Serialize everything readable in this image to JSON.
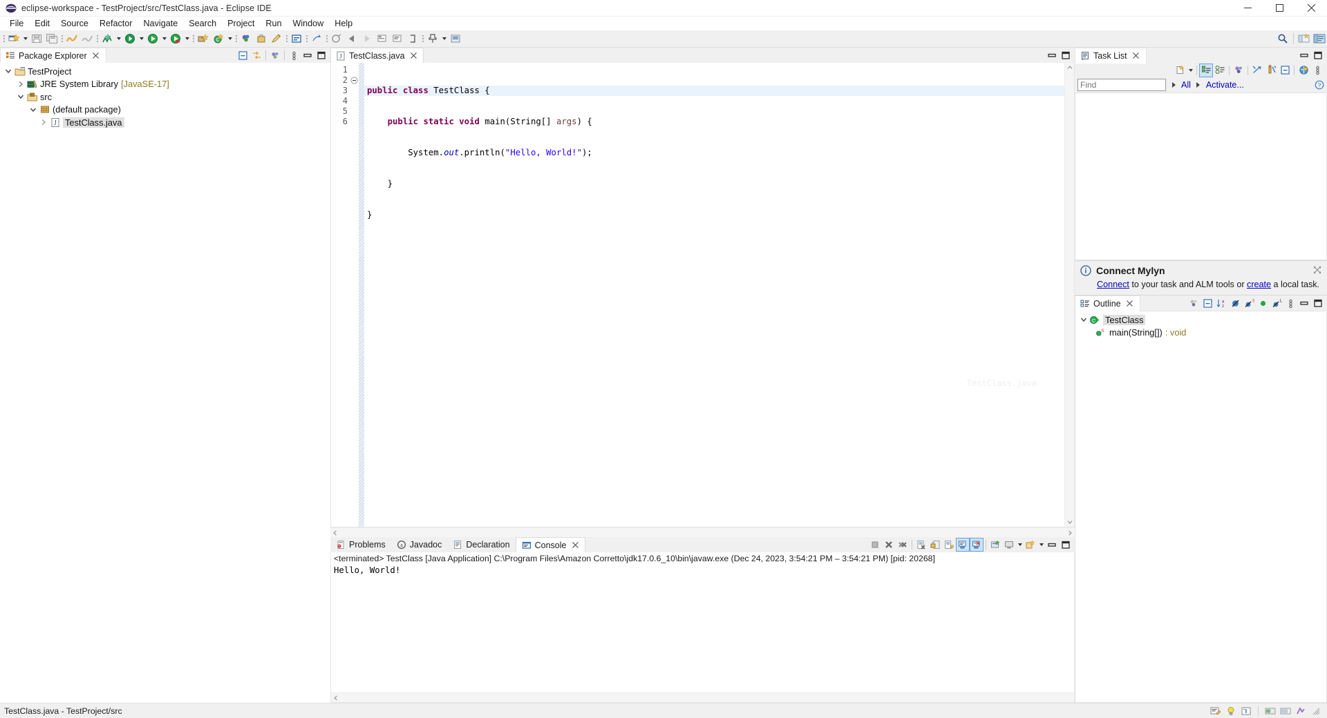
{
  "window": {
    "title": "eclipse-workspace - TestProject/src/TestClass.java - Eclipse IDE",
    "app_icon": "eclipse-icon",
    "minimize_label": "Minimize",
    "maximize_label": "Maximize",
    "close_label": "Close"
  },
  "menubar": {
    "items": [
      {
        "label": "File"
      },
      {
        "label": "Edit"
      },
      {
        "label": "Source"
      },
      {
        "label": "Refactor"
      },
      {
        "label": "Navigate"
      },
      {
        "label": "Search"
      },
      {
        "label": "Project"
      },
      {
        "label": "Run"
      },
      {
        "label": "Window"
      },
      {
        "label": "Help"
      }
    ]
  },
  "toolbar": {
    "items": [
      {
        "icon": "new-wizard-icon",
        "name": "new-button",
        "dropdown": true
      },
      {
        "icon": "save-icon",
        "name": "save-button",
        "dropdown": false
      },
      {
        "icon": "save-all-icon",
        "name": "save-all-button",
        "dropdown": false
      },
      {
        "icon": "build-all-icon",
        "name": "build-all-button",
        "dropdown": false
      },
      {
        "icon": "build-project-icon",
        "name": "build-project-button",
        "dropdown": false
      },
      {
        "icon": "new-java-project-icon",
        "name": "new-java-project-button",
        "dropdown": true
      },
      {
        "icon": "debug-icon",
        "name": "debug-button",
        "dropdown": true
      },
      {
        "icon": "run-icon",
        "name": "run-button",
        "dropdown": true
      },
      {
        "icon": "coverage-icon",
        "name": "coverage-button",
        "dropdown": true
      },
      {
        "icon": "new-package-icon",
        "name": "new-package-button",
        "dropdown": false
      },
      {
        "icon": "new-class-icon",
        "name": "new-class-button",
        "dropdown": true
      },
      {
        "icon": "search-global-icon",
        "name": "open-type-button",
        "dropdown": false
      },
      {
        "icon": "open-task-icon",
        "name": "open-task-button",
        "dropdown": false
      },
      {
        "icon": "last-edit-icon",
        "name": "last-edit-location-button",
        "dropdown": false
      },
      {
        "icon": "toggle-mark-occurrences-icon",
        "name": "toggle-mark-occurrences-button",
        "dropdown": false
      },
      {
        "icon": "prev-annotation-icon",
        "name": "previous-annotation-button",
        "dropdown": false
      },
      {
        "icon": "next-annotation-icon",
        "name": "next-annotation-button",
        "dropdown": false
      },
      {
        "icon": "back-icon",
        "name": "back-button",
        "dropdown": true
      },
      {
        "icon": "forward-icon",
        "name": "forward-button",
        "dropdown": true
      },
      {
        "icon": "pin-editor-icon",
        "name": "pin-editor-button",
        "dropdown": false
      }
    ],
    "right_items": [
      {
        "icon": "search-icon",
        "name": "quick-access-search"
      },
      {
        "icon": "open-perspective-icon",
        "name": "open-perspective-button"
      },
      {
        "icon": "java-perspective-icon",
        "name": "java-perspective-button"
      }
    ]
  },
  "package_explorer": {
    "tab_label": "Package Explorer",
    "tab_icon": "package-explorer-icon",
    "tools": [
      {
        "icon": "collapse-all-icon",
        "name": "collapse-all-button"
      },
      {
        "icon": "link-with-editor-icon",
        "name": "link-with-editor-button"
      },
      {
        "icon": "focus-on-active-task-icon",
        "name": "focus-on-active-task-button"
      },
      {
        "icon": "view-menu-icon",
        "name": "view-menu-button"
      },
      {
        "icon": "minimize-icon",
        "name": "minimize-view-button"
      },
      {
        "icon": "maximize-icon",
        "name": "maximize-view-button"
      }
    ],
    "tree": [
      {
        "label": "TestProject",
        "suffix": "",
        "indent": 0,
        "twisty": "down",
        "icon": "java-project-icon",
        "selected": false
      },
      {
        "label": "JRE System Library",
        "suffix": "[JavaSE-17]",
        "indent": 1,
        "twisty": "right",
        "icon": "library-icon",
        "selected": false
      },
      {
        "label": "src",
        "suffix": "",
        "indent": 1,
        "twisty": "down",
        "icon": "source-folder-icon",
        "selected": false
      },
      {
        "label": "(default package)",
        "suffix": "",
        "indent": 2,
        "twisty": "down",
        "icon": "package-icon",
        "selected": false
      },
      {
        "label": "TestClass.java",
        "suffix": "",
        "indent": 3,
        "twisty": "right",
        "icon": "java-file-icon",
        "selected": true
      }
    ]
  },
  "editor": {
    "tab_label": "TestClass.java",
    "tab_icon": "java-file-icon",
    "tools": [
      {
        "icon": "restore-icon",
        "name": "restore-editor-button"
      },
      {
        "icon": "maximize-icon",
        "name": "maximize-editor-button"
      }
    ],
    "watermark": "TestClass.java",
    "line_numbers": [
      "1",
      "2",
      "3",
      "4",
      "5",
      "6"
    ],
    "fold_markers": [
      "",
      "collapse",
      "",
      "",
      "",
      ""
    ],
    "current_line": 1,
    "code_lines": [
      [
        {
          "t": "public ",
          "c": "kw"
        },
        {
          "t": "class ",
          "c": "kw"
        },
        {
          "t": "TestClass {",
          "c": "plain"
        }
      ],
      [
        {
          "t": "    ",
          "c": "plain"
        },
        {
          "t": "public static void ",
          "c": "kw"
        },
        {
          "t": "main(",
          "c": "plain"
        },
        {
          "t": "String",
          "c": "plain"
        },
        {
          "t": "[] ",
          "c": "plain"
        },
        {
          "t": "args",
          "c": "pv"
        },
        {
          "t": ") {",
          "c": "plain"
        }
      ],
      [
        {
          "t": "        System.",
          "c": "plain"
        },
        {
          "t": "out",
          "c": "fld"
        },
        {
          "t": ".println(",
          "c": "plain"
        },
        {
          "t": "\"Hello, World!\"",
          "c": "str"
        },
        {
          "t": ");",
          "c": "plain"
        }
      ],
      [
        {
          "t": "    }",
          "c": "plain"
        }
      ],
      [
        {
          "t": "}",
          "c": "plain"
        }
      ],
      [
        {
          "t": "",
          "c": "plain"
        }
      ]
    ]
  },
  "bottom_panel": {
    "tabs": [
      {
        "label": "Problems",
        "icon": "problems-icon",
        "active": false,
        "closable": false
      },
      {
        "label": "Javadoc",
        "icon": "javadoc-icon",
        "active": false,
        "closable": false
      },
      {
        "label": "Declaration",
        "icon": "declaration-icon",
        "active": false,
        "closable": false
      },
      {
        "label": "Console",
        "icon": "console-icon",
        "active": true,
        "closable": true
      }
    ],
    "tools": [
      {
        "icon": "terminate-icon",
        "name": "terminate-button"
      },
      {
        "icon": "remove-launch-icon",
        "name": "remove-launch-button"
      },
      {
        "icon": "remove-all-terminated-icon",
        "name": "remove-all-terminated-button"
      },
      {
        "icon": "clear-console-icon",
        "name": "clear-console-button"
      },
      {
        "icon": "scroll-lock-icon",
        "name": "scroll-lock-button"
      },
      {
        "icon": "word-wrap-icon",
        "name": "word-wrap-button"
      },
      {
        "icon": "show-console-on-output-icon",
        "name": "show-console-on-output-button"
      },
      {
        "icon": "show-console-on-error-icon",
        "name": "show-console-on-error-button"
      },
      {
        "icon": "pin-console-icon",
        "name": "pin-console-button"
      },
      {
        "icon": "display-selected-console-icon",
        "name": "display-selected-console-button"
      },
      {
        "icon": "open-console-icon",
        "name": "open-console-button"
      },
      {
        "icon": "minimize-icon",
        "name": "minimize-panel-button"
      },
      {
        "icon": "maximize-icon",
        "name": "maximize-panel-button"
      }
    ],
    "console_header": "<terminated> TestClass [Java Application] C:\\Program Files\\Amazon Corretto\\jdk17.0.6_10\\bin\\javaw.exe (Dec 24, 2023, 3:54:21 PM – 3:54:21 PM) [pid: 20268]",
    "console_output": "Hello, World!"
  },
  "task_list": {
    "tab_label": "Task List",
    "tab_icon": "task-list-icon",
    "header_tools": [
      {
        "icon": "minimize-icon",
        "name": "minimize-view-button"
      },
      {
        "icon": "maximize-icon",
        "name": "maximize-view-button"
      }
    ],
    "toolbar": [
      {
        "icon": "new-task-icon",
        "name": "new-task-button",
        "dropdown": true
      },
      {
        "icon": "categorized-presentation-icon",
        "name": "categorized-presentation-button",
        "active": true
      },
      {
        "icon": "scheduled-presentation-icon",
        "name": "scheduled-presentation-button",
        "active": false
      },
      {
        "icon": "focus-on-workweek-icon",
        "name": "focus-on-workweek-button",
        "active": false
      },
      {
        "icon": "synchronize-changed-icon",
        "name": "synchronize-changed-button",
        "active": false
      },
      {
        "icon": "collapse-all-tasks-icon",
        "name": "collapse-all-button",
        "active": false
      },
      {
        "icon": "restore-tasks-icon",
        "name": "restore-tasks-button",
        "active": false
      },
      {
        "icon": "view-menu-icon",
        "name": "view-menu-button",
        "active": false
      }
    ],
    "find_placeholder": "Find",
    "find_value": "",
    "filter_all_label": "All",
    "activate_label": "Activate...",
    "help_icon": "help-icon"
  },
  "mylyn": {
    "info_icon": "info-icon",
    "title": "Connect Mylyn",
    "text_before": "",
    "link1": "Connect",
    "mid": " to your task and ALM tools or ",
    "link2": "create",
    "text_after": " a local task.",
    "close_icon": "close-icon"
  },
  "outline": {
    "tab_label": "Outline",
    "tab_icon": "outline-icon",
    "tools": [
      {
        "icon": "focus-on-active-task-icon",
        "name": "focus-on-active-task-button"
      },
      {
        "icon": "collapse-all-icon",
        "name": "collapse-all-button"
      },
      {
        "icon": "sort-icon",
        "name": "sort-button"
      },
      {
        "icon": "hide-fields-icon",
        "name": "hide-fields-button"
      },
      {
        "icon": "hide-static-icon",
        "name": "hide-static-button"
      },
      {
        "icon": "hide-nonpublic-icon",
        "name": "hide-nonpublic-button"
      },
      {
        "icon": "hide-local-types-icon",
        "name": "hide-local-types-button"
      },
      {
        "icon": "view-menu-icon",
        "name": "view-menu-button"
      },
      {
        "icon": "minimize-icon",
        "name": "minimize-view-button"
      },
      {
        "icon": "maximize-icon",
        "name": "maximize-view-button"
      }
    ],
    "tree": [
      {
        "label": "TestClass",
        "suffix": "",
        "indent": 0,
        "twisty": "down",
        "icon": "class-icon",
        "selected": true
      },
      {
        "label": "main(String[])",
        "suffix": ": void",
        "indent": 1,
        "twisty": "none",
        "icon": "public-static-method-icon",
        "selected": false
      }
    ]
  },
  "statusbar": {
    "text": "TestClass.java - TestProject/src",
    "right_items": [
      {
        "icon": "writable-icon",
        "name": "writable-indicator"
      },
      {
        "icon": "tip-icon",
        "name": "tip-indicator"
      },
      {
        "icon": "smart-insert-icon",
        "name": "insert-mode-indicator"
      },
      {
        "icon": "build-indicator-icon",
        "name": "build-indicator"
      },
      {
        "icon": "heap-status-icon",
        "name": "heap-status"
      },
      {
        "icon": "mylyn-status-icon",
        "name": "mylyn-status"
      },
      {
        "icon": "resize-handle-icon",
        "name": "resize-handle"
      }
    ]
  },
  "colors": {
    "accent": "#0000c0",
    "keyword": "#7f0055",
    "string": "#2a00ff",
    "field": "#0000c0",
    "param": "#6a3e3e",
    "chrome": "#f0f0f0",
    "selection": "#e0e0e0",
    "current_line": "#eaf2fb"
  }
}
